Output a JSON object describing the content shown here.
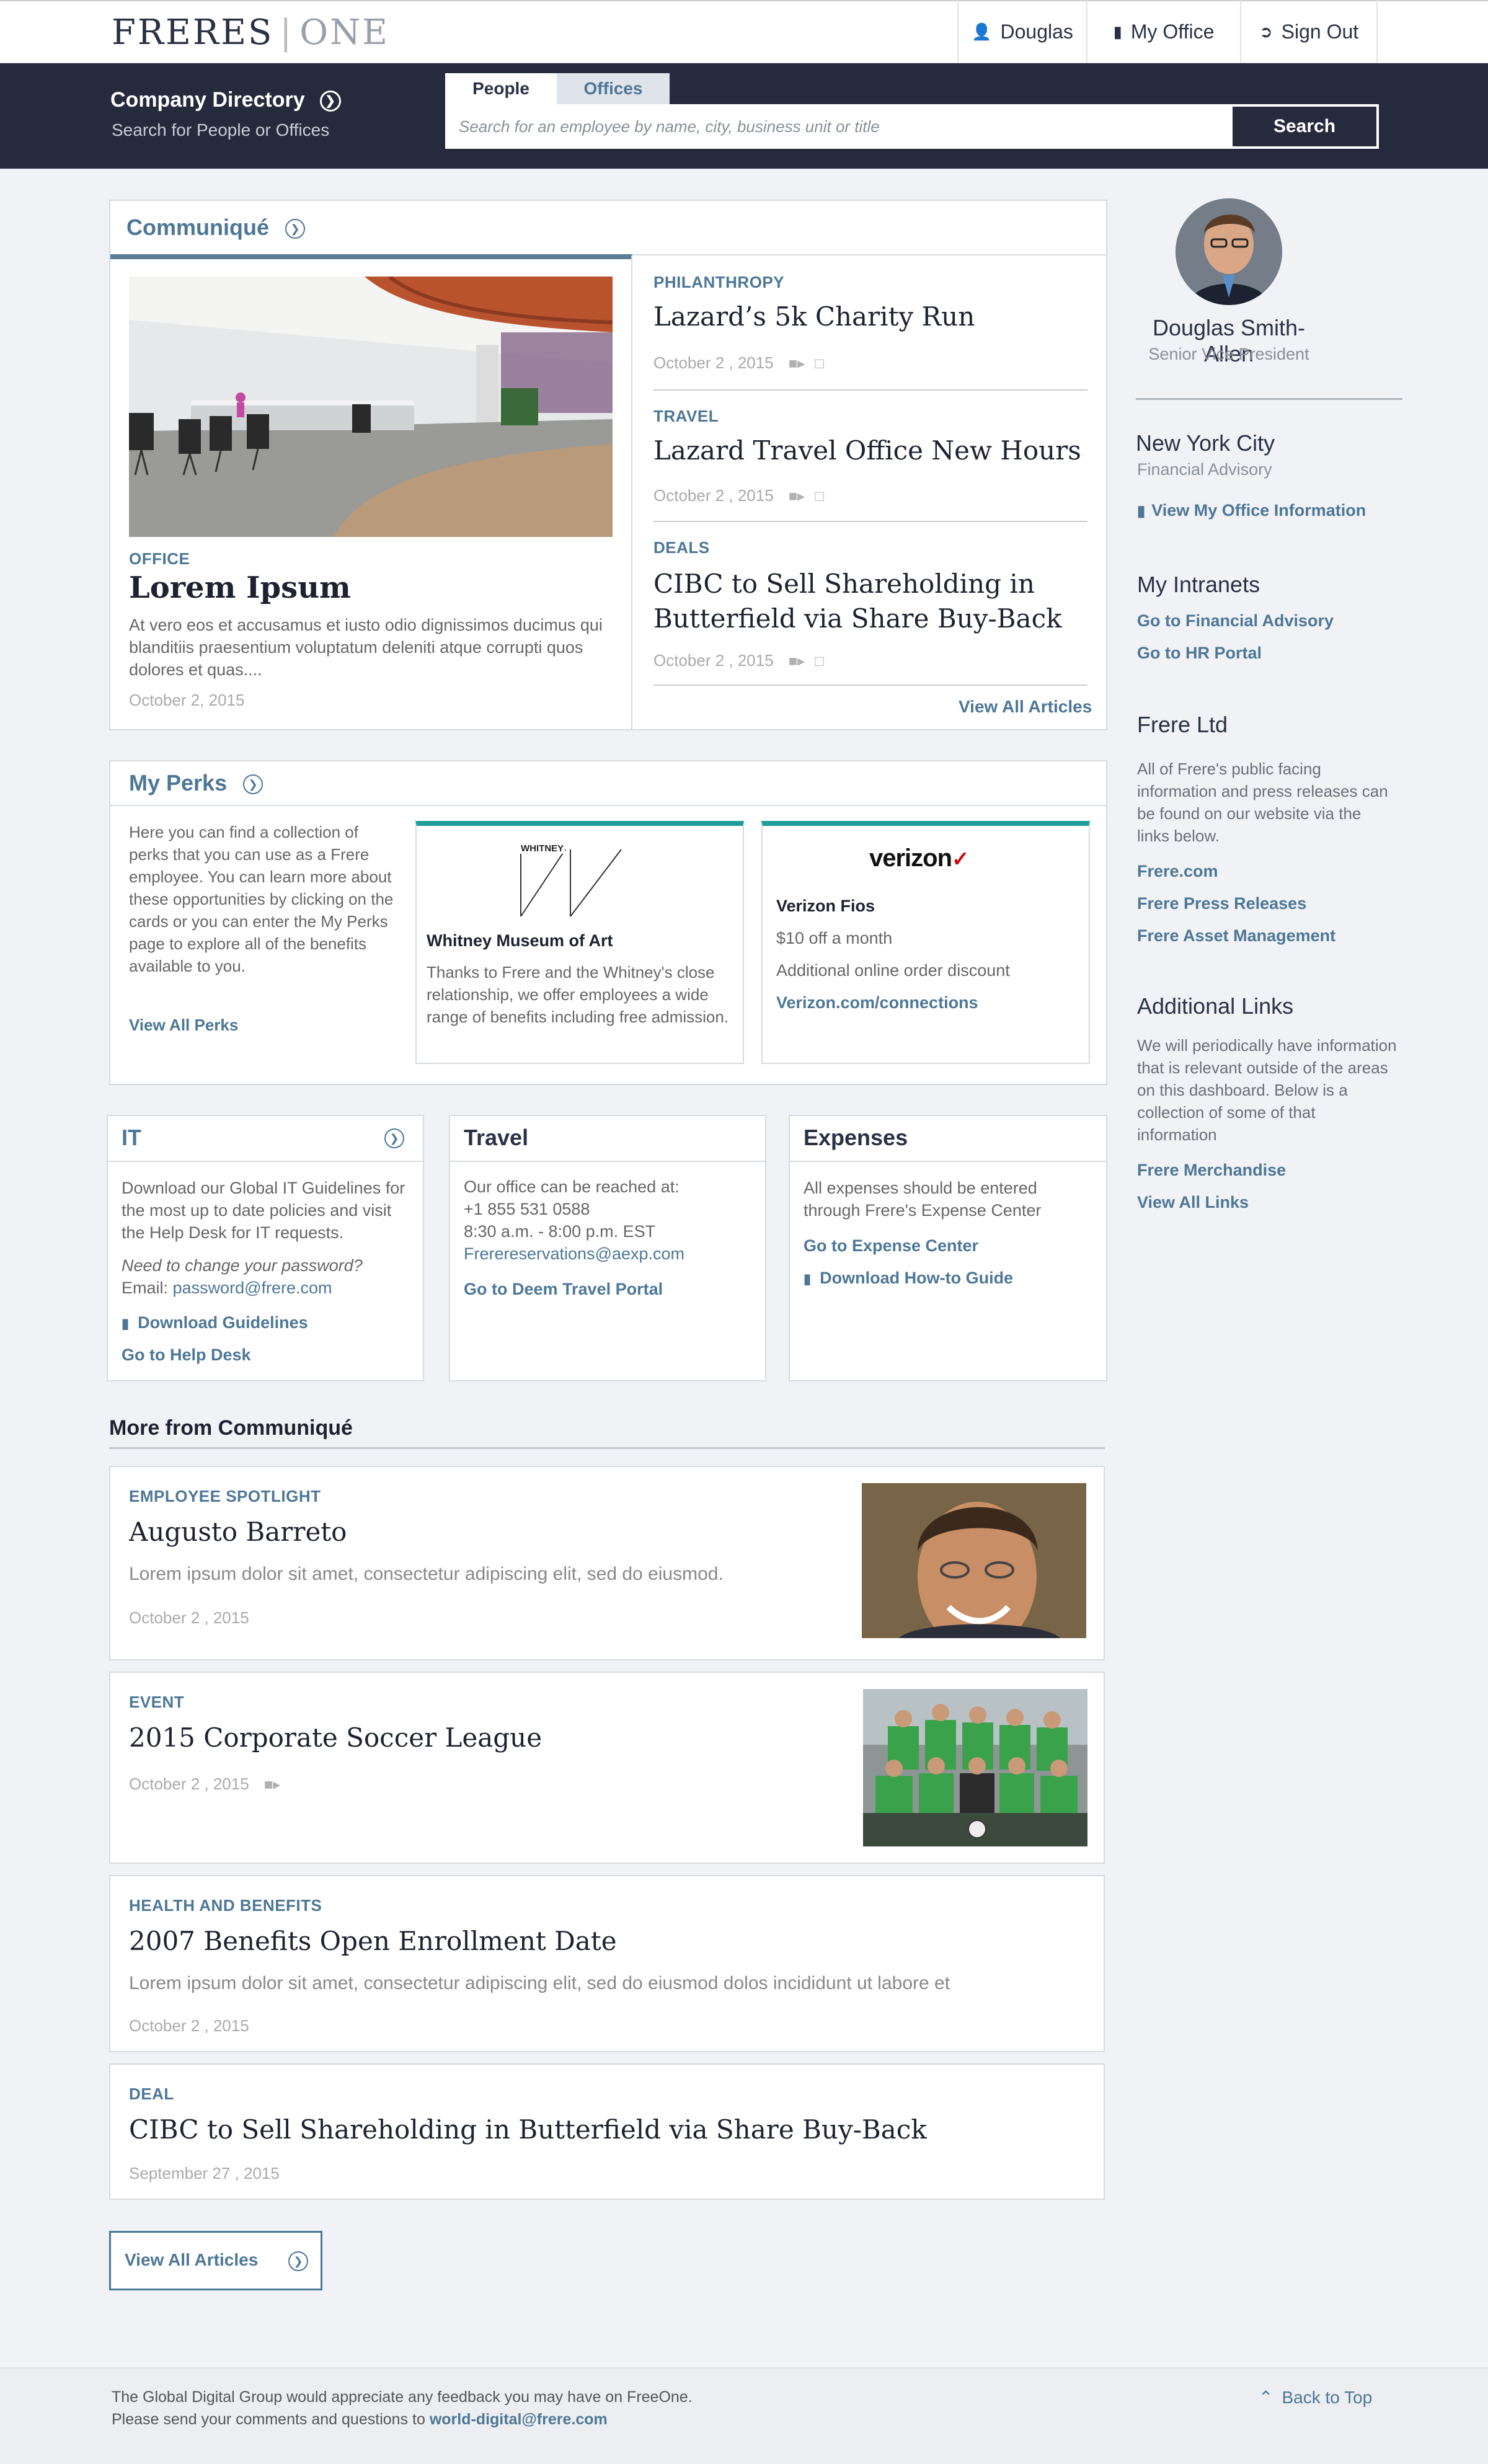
{
  "header": {
    "logo_left": "FRERES",
    "logo_sep": "|",
    "logo_right": "ONE",
    "nav": {
      "user": "Douglas",
      "office": "My Office",
      "signout": "Sign Out"
    }
  },
  "directory": {
    "title": "Company Directory",
    "subtitle": "Search for People or Offices",
    "tabs": [
      "People",
      "Offices"
    ],
    "search_placeholder": "Search for an employee by name, city, business unit or title",
    "search_button": "Search"
  },
  "communique": {
    "title": "Communiqué",
    "feature": {
      "kicker": "OFFICE",
      "title": "Lorem Ipsum",
      "body": "At vero eos et accusamus et iusto odio dignissimos ducimus qui blanditiis praesentium voluptatum deleniti atque corrupti quos dolores et quas....",
      "date": "October 2, 2015"
    },
    "articles": [
      {
        "kicker": "PHILANTHROPY",
        "title": "Lazard’s 5k Charity Run",
        "date": "October 2 , 2015"
      },
      {
        "kicker": "TRAVEL",
        "title": "Lazard Travel Office New Hours",
        "date": "October 2 , 2015"
      },
      {
        "kicker": "DEALS",
        "title_line1": "CIBC to Sell Shareholding in",
        "title_line2": "Butterfield via Share Buy-Back",
        "date": "October 2 , 2015"
      }
    ],
    "view_all": "View All Articles"
  },
  "perks": {
    "title": "My Perks",
    "intro": "Here you can find a collection of perks that you can use as a Frere employee. You can learn more about these opportunities by clicking on the cards or you can enter the My Perks page to explore all of the benefits available to you.",
    "view_all": "View All Perks",
    "whitney": {
      "logo": "WHITNEY",
      "name": "Whitney Museum of Art",
      "desc": "Thanks to Frere and the Whitney's close relationship, we offer employees a wide range of benefits including free admission."
    },
    "verizon": {
      "logo": "verizon",
      "name": "Verizon Fios",
      "offer": "$10 off a month",
      "extra": "Additional online order discount",
      "link": "Verizon.com/connections"
    }
  },
  "it": {
    "title": "IT",
    "body": "Download our Global IT Guidelines for the most up to date policies and visit the Help Desk for IT requests.",
    "password_q": "Need to change your password?",
    "email_label": "Email:",
    "email": "password@frere.com",
    "download": "Download Guidelines",
    "helpdesk": "Go to Help Desk"
  },
  "travel": {
    "title": "Travel",
    "line1": "Our office can be reached at:",
    "phone": "+1 855 531 0588",
    "hours": "8:30 a.m. - 8:00 p.m.  EST",
    "email": "Frerereservations@aexp.com",
    "portal": "Go to Deem Travel Portal"
  },
  "expenses": {
    "title": "Expenses",
    "body": "All expenses should be entered through Frere's Expense Center",
    "center": "Go to Expense Center",
    "guide": "Download How-to Guide"
  },
  "more": {
    "title": "More from Communiqué",
    "stories": [
      {
        "kicker": "EMPLOYEE SPOTLIGHT",
        "title": "Augusto Barreto",
        "body": "Lorem ipsum dolor sit amet, consectetur adipiscing elit, sed do eiusmod.",
        "date": "October 2 , 2015"
      },
      {
        "kicker": "EVENT",
        "title": "2015 Corporate Soccer League",
        "date": "October 2 , 2015"
      },
      {
        "kicker": "HEALTH AND BENEFITS",
        "title": "2007 Benefits Open Enrollment Date",
        "body": "Lorem ipsum dolor sit amet, consectetur adipiscing elit, sed do eiusmod dolos incididunt ut labore et",
        "date": "October 2 , 2015"
      },
      {
        "kicker": "DEAL",
        "title": "CIBC to Sell Shareholding in Butterfield via Share Buy-Back",
        "date": "September 27 , 2015"
      }
    ],
    "view_all": "View All Articles"
  },
  "sidebar": {
    "name": "Douglas Smith-Allen",
    "role": "Senior Vice President",
    "city": "New York City",
    "unit": "Financial Advisory",
    "office_link": "View My Office Information",
    "intranets_title": "My Intranets",
    "intranets": [
      "Go to Financial Advisory",
      "Go to HR Portal"
    ],
    "frere_title": "Frere Ltd",
    "frere_body": "All of Frere's public facing information and press releases can be found on our website via the links below.",
    "frere_links": [
      "Frere.com",
      "Frere Press Releases",
      "Frere Asset Management"
    ],
    "additional_title": "Additional Links",
    "additional_body": "We will periodically have information that is relevant outside of the areas on this dashboard. Below is a collection of some of that information",
    "additional_links": [
      "Frere Merchandise",
      "View All Links"
    ]
  },
  "footer": {
    "line1": "The Global Digital Group would appreciate any feedback you may have on FreeOne.",
    "line2": "Please send your comments and questions to",
    "email": "world-digital@frere.com",
    "back_to_top": "Back to Top"
  },
  "colors": {
    "navy": "#252a3d",
    "accent": "#4d7796",
    "teal": "#1f9e98",
    "verizon_red": "#cd040b"
  }
}
